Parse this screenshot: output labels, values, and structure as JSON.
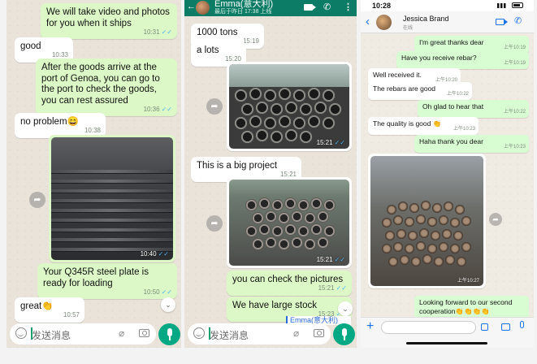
{
  "left_chat": {
    "messages": [
      {
        "text": "We will take video and photos for you when it ships",
        "time": "10:31"
      },
      {
        "text": "good",
        "time": "10:33"
      },
      {
        "text": "After the goods arrive at the port of Genoa, you can go to the port to check the goods, you can rest assured",
        "time": "10:36"
      },
      {
        "text": "no problem😄",
        "time": "10:38"
      },
      {
        "time": "10:40"
      },
      {
        "text": "Your Q345R steel plate is ready for loading",
        "time": "10:50"
      },
      {
        "text": "great👏",
        "time": "10:57"
      }
    ],
    "input_placeholder": "发送消息"
  },
  "middle_chat": {
    "contact_name": "Emma(意大利)",
    "contact_status": "最后于昨日 17:38 上线",
    "messages": [
      {
        "text": "1000 tons",
        "time": "15:19"
      },
      {
        "text": "a lots",
        "time": "15:20"
      },
      {
        "time": "15:21"
      },
      {
        "text": "This is a big project",
        "time": "15:21"
      },
      {
        "time": "15:21"
      },
      {
        "text": "you can check the pictures",
        "time": "15:21"
      },
      {
        "text": "We have large stock",
        "time": "15:23"
      }
    ],
    "quoted_name": "Emma(意大利)",
    "input_placeholder": "发送消息"
  },
  "right_chat": {
    "status_time": "10:28",
    "contact_name": "Jessica Brand",
    "contact_status": "在线",
    "messages": [
      {
        "text": "I'm great thanks dear",
        "time": "上午10:19"
      },
      {
        "text": "Have you receive rebar?",
        "time": "上午10:19"
      },
      {
        "text": "Well received it.",
        "time": "上午10:20"
      },
      {
        "text": "The rebars are good",
        "time": "上午10:22"
      },
      {
        "text": "Oh glad to hear that",
        "time": "上午10:22"
      },
      {
        "text": "The quality is good 👏",
        "time": "上午10:23"
      },
      {
        "text": "Haha thank you dear",
        "time": "上午10:23"
      },
      {
        "time": "上午10:27"
      },
      {
        "text": "Looking forward to our second cooperation👏👏👏👏",
        "time": ""
      }
    ]
  }
}
